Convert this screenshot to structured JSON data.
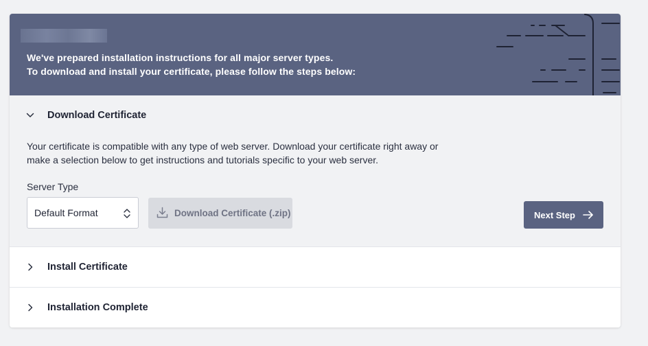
{
  "banner": {
    "line1": "We've prepared installation instructions for all major server types.",
    "line2": "To download and install your certificate, please follow the steps below:"
  },
  "steps": [
    {
      "title": "Download Certificate",
      "expanded": true,
      "description": "Your certificate is compatible with any type of web server. Download your certificate right away or make a selection below to get instructions and tutorials specific to your web server.",
      "server_type_label": "Server Type",
      "server_type_value": "Default Format",
      "download_label": "Download Certificate (.zip)",
      "next_label": "Next Step"
    },
    {
      "title": "Install Certificate",
      "expanded": false
    },
    {
      "title": "Installation Complete",
      "expanded": false
    }
  ],
  "colors": {
    "banner_bg": "#5a6381",
    "accent": "#5a6381",
    "disabled_button": "#d9dbe0",
    "page_bg": "#f1f2f4"
  },
  "icons": {
    "expanded": "chevron-down-icon",
    "collapsed": "chevron-right-icon",
    "select": "updown-icon",
    "download": "download-icon",
    "next": "arrow-right-icon"
  }
}
